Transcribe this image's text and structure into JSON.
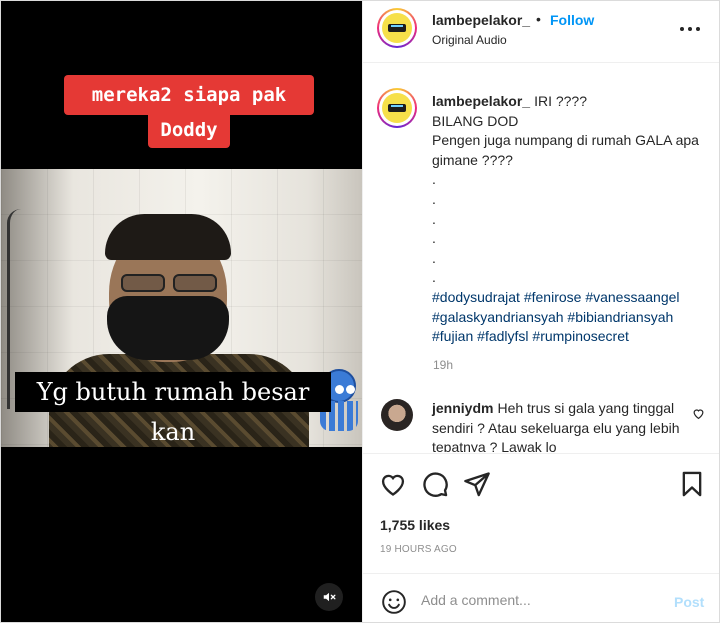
{
  "video": {
    "overlay_text_1": "mereka2 siapa pak",
    "overlay_text_2": "Doddy",
    "subtitle": "Yg butuh rumah besar kan",
    "muted": true
  },
  "header": {
    "username": "lambepelakor_",
    "dot": "•",
    "follow_label": "Follow",
    "audio": "Original Audio"
  },
  "caption": {
    "username": "lambepelakor_",
    "lines": [
      "IRI ????",
      "BILANG DOD",
      "Pengen juga numpang di rumah GALA apa gimane ????",
      ".",
      ".",
      ".",
      ".",
      ".",
      "."
    ],
    "hashtags": [
      "#dodysudrajat",
      "#fenirose",
      "#vanessaangel",
      "#galaskyandriansyah",
      "#bibiandriansyah",
      "#fujian",
      "#fadlyfsl",
      "#rumpinosecret"
    ],
    "time": "19h"
  },
  "comment": {
    "username": "jenniydm",
    "text": "Heh trus si gala yang tinggal sendiri ? Atau sekeluarga elu yang lebih tepatnya ? Lawak lo"
  },
  "stats": {
    "likes": "1,755 likes",
    "posted": "19 HOURS AGO"
  },
  "add_comment": {
    "placeholder": "Add a comment...",
    "post_label": "Post"
  },
  "colors": {
    "follow_blue": "#0095f6",
    "hashtag": "#00376b",
    "overlay_red": "#e53935",
    "post_disabled": "#b2dffc"
  }
}
